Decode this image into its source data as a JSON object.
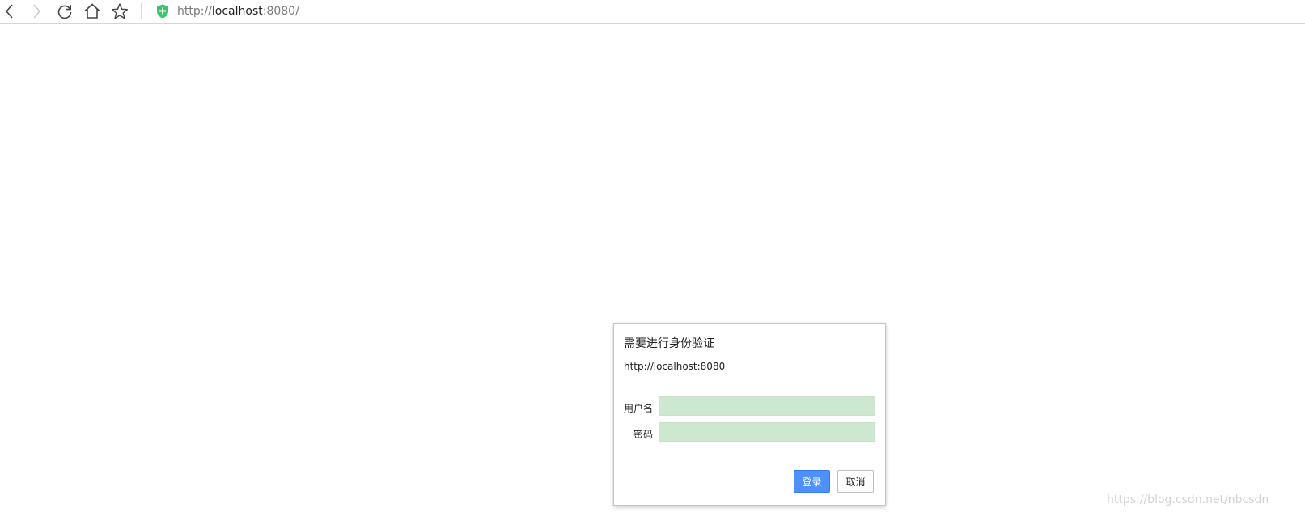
{
  "browser": {
    "address_bar": {
      "scheme": "http://",
      "host": "localhost",
      "port": ":8080/"
    },
    "icons": {
      "back": "back-arrow-icon",
      "forward": "forward-arrow-icon",
      "reload": "reload-icon",
      "home": "home-icon",
      "bookmark": "star-icon",
      "security": "shield-plus-icon"
    },
    "colors": {
      "shield": "#3cc46e",
      "toolbar_border": "#d6d6d6"
    }
  },
  "auth_dialog": {
    "title": "需要进行身份验证",
    "origin": "http://localhost:8080",
    "username_label": "用户名",
    "username_value": "",
    "password_label": "密码",
    "password_value": "",
    "login_button": "登录",
    "cancel_button": "取消",
    "colors": {
      "input_background": "#cde8d1",
      "login_button": "#4d90fe"
    }
  },
  "watermark": "https://blog.csdn.net/nbcsdn"
}
